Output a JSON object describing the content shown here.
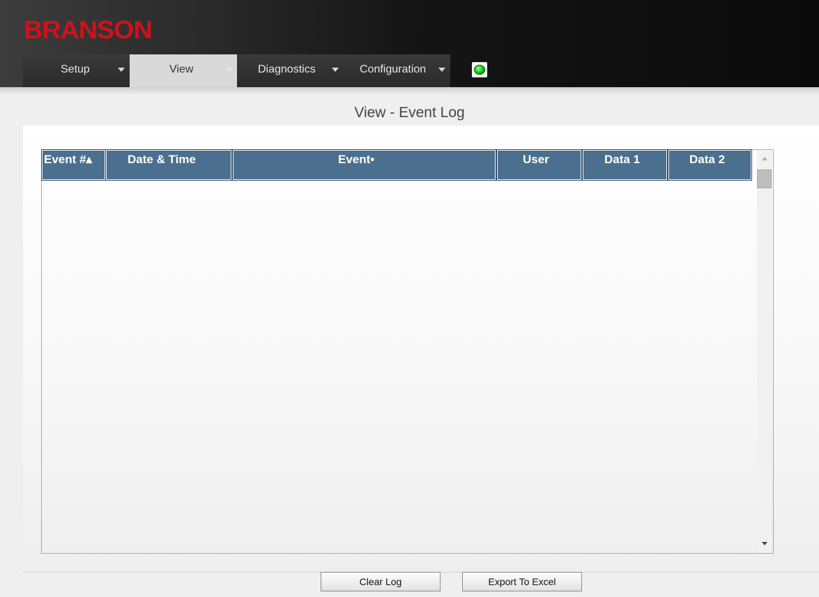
{
  "brand": {
    "logo_text": "BRANSON",
    "logo_color": "#d0111b"
  },
  "nav": {
    "items": [
      {
        "label": "Setup"
      },
      {
        "label": "View"
      },
      {
        "label": "Diagnostics"
      },
      {
        "label": "Configuration"
      }
    ],
    "active": "View"
  },
  "status": {
    "state": "online",
    "color": "#00c000"
  },
  "page": {
    "title": "View - Event Log"
  },
  "table": {
    "columns": [
      "Event #▴",
      "Date & Time",
      "Event•",
      "User",
      "Data 1",
      "Data 2"
    ],
    "rows": []
  },
  "buttons": {
    "clear": "Clear Log",
    "export": "Export To Excel"
  },
  "colors": {
    "header_accent": "#4b6f8f",
    "grid_border": "#8dbb8d"
  }
}
